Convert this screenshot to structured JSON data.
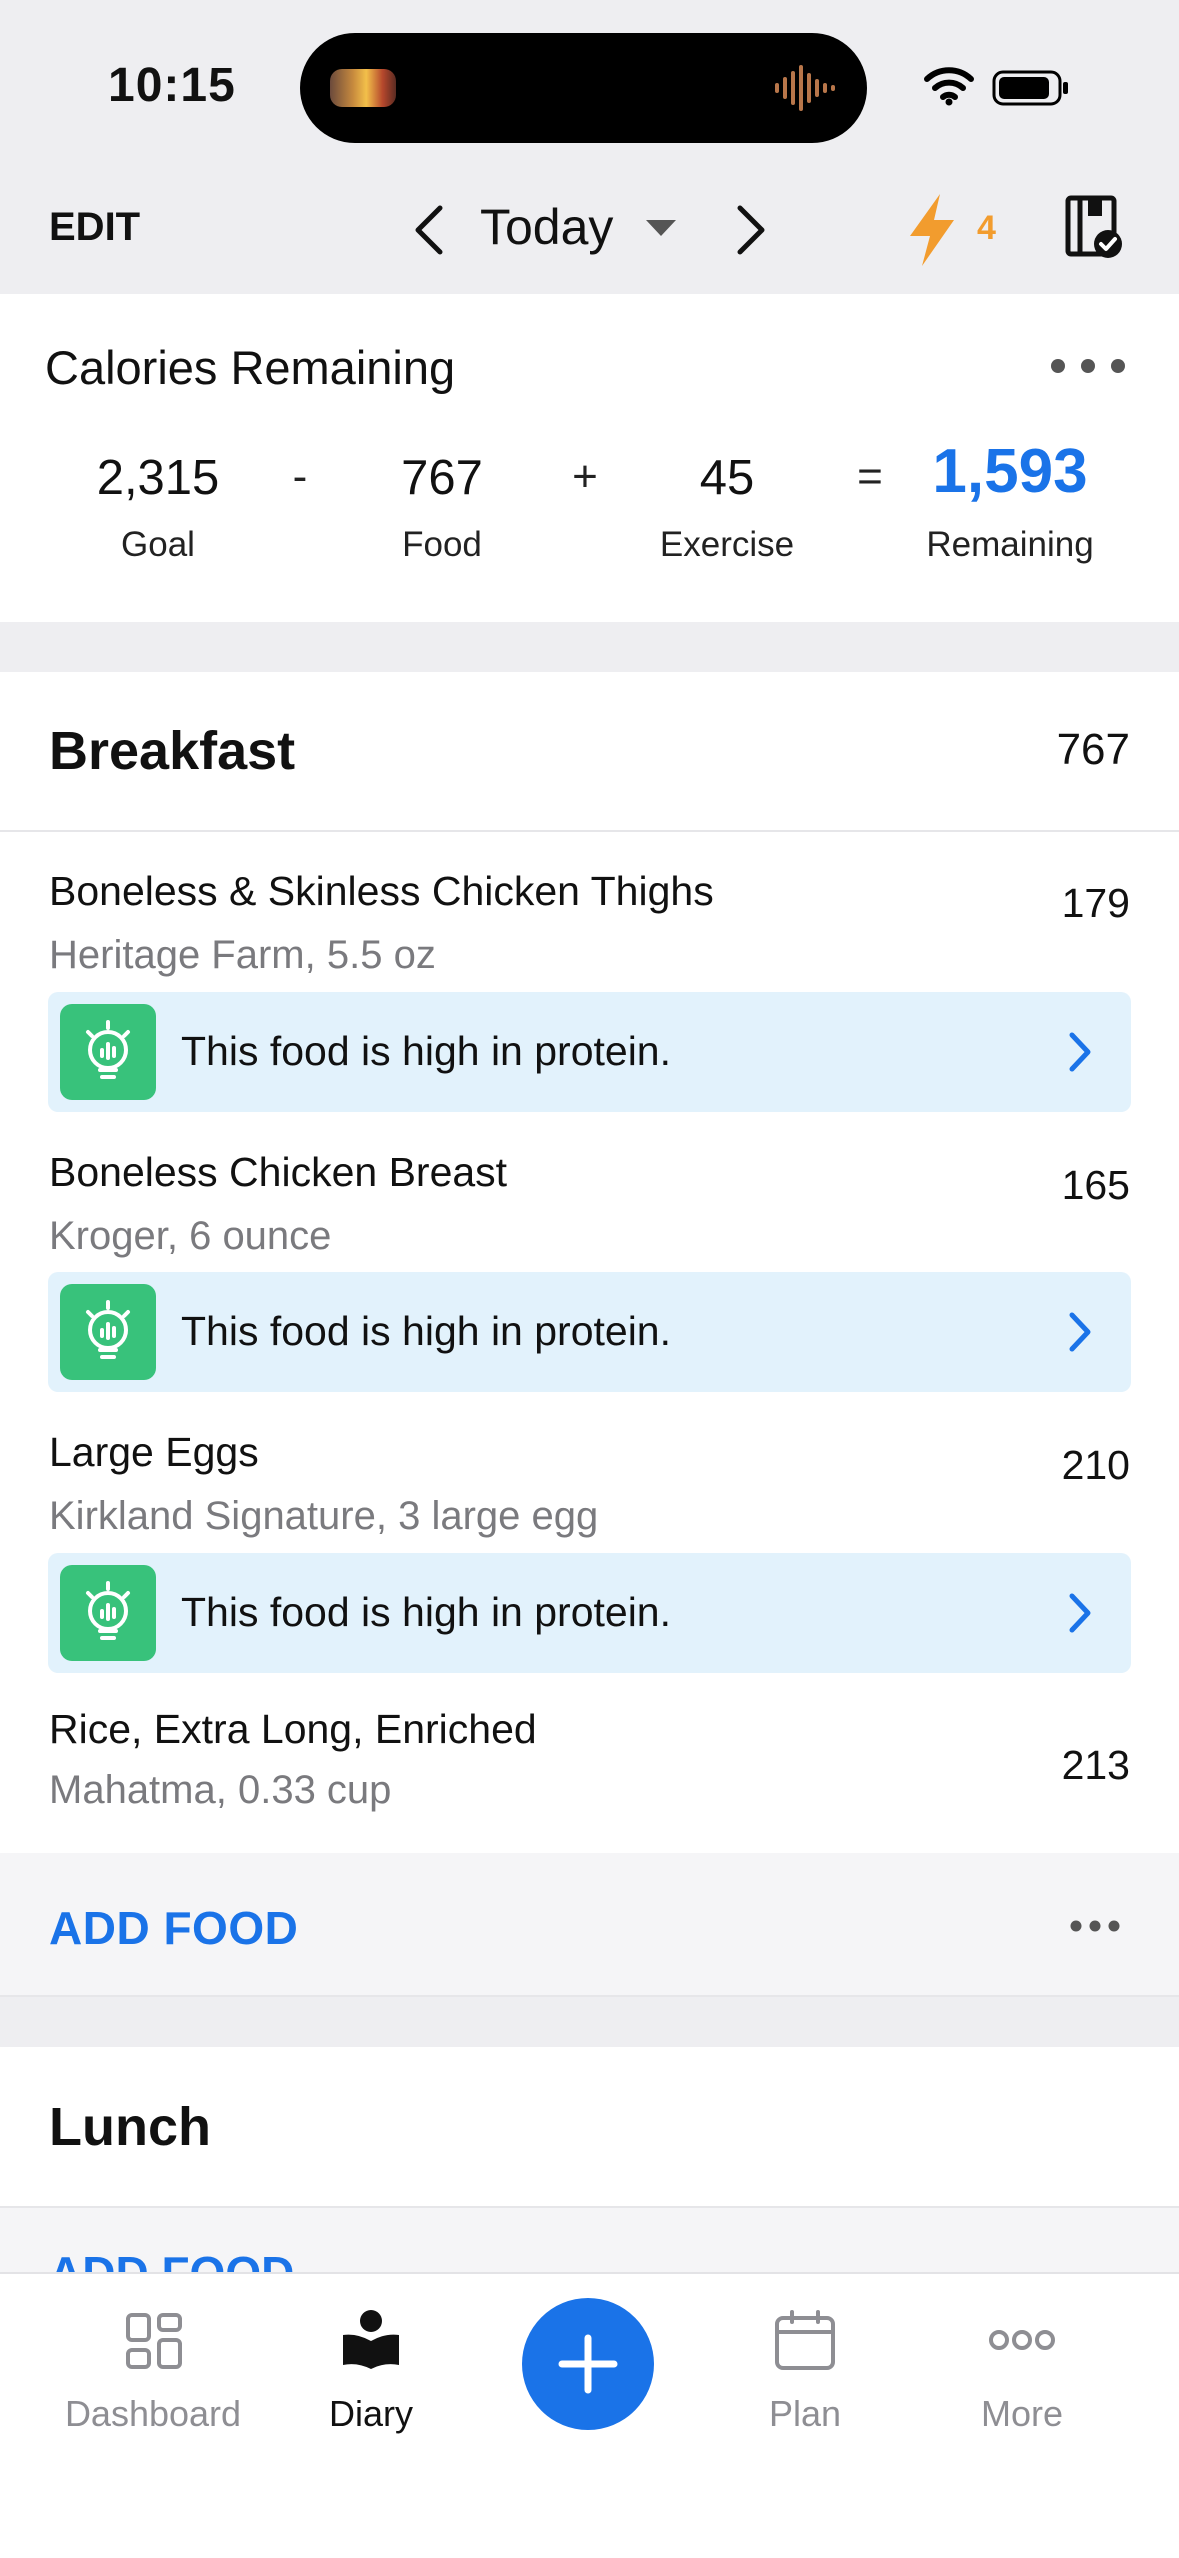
{
  "status_bar": {
    "time": "10:15"
  },
  "header": {
    "edit_label": "EDIT",
    "date_label": "Today",
    "streak_count": "4",
    "accent_color": "#f29c2e"
  },
  "calories": {
    "title": "Calories Remaining",
    "goal": {
      "value": "2,315",
      "label": "Goal"
    },
    "op_minus": "-",
    "food": {
      "value": "767",
      "label": "Food"
    },
    "op_plus": "+",
    "exercise": {
      "value": "45",
      "label": "Exercise"
    },
    "op_equals": "=",
    "remaining": {
      "value": "1,593",
      "label": "Remaining",
      "color": "#1a73e8"
    }
  },
  "breakfast": {
    "name": "Breakfast",
    "total": "767",
    "items": [
      {
        "name": "Boneless & Skinless Chicken Thighs",
        "detail": "Heritage Farm, 5.5 oz",
        "calories": "179",
        "insight": "This food is high in protein."
      },
      {
        "name": "Boneless Chicken Breast",
        "detail": "Kroger, 6 ounce",
        "calories": "165",
        "insight": "This food is high in protein."
      },
      {
        "name": "Large Eggs",
        "detail": "Kirkland Signature, 3 large egg",
        "calories": "210",
        "insight": "This food is high in protein."
      },
      {
        "name": "Rice, Extra Long, Enriched",
        "detail": "Mahatma, 0.33 cup",
        "calories": "213"
      }
    ],
    "add_food_label": "ADD FOOD"
  },
  "lunch": {
    "name": "Lunch",
    "add_food_label": "ADD FOOD"
  },
  "tabbar": {
    "tabs": [
      {
        "label": "Dashboard",
        "icon": "dashboard-icon"
      },
      {
        "label": "Diary",
        "icon": "diary-icon",
        "active": true
      },
      {
        "label": "Plan",
        "icon": "calendar-icon"
      },
      {
        "label": "More",
        "icon": "more-icon"
      }
    ],
    "add_button_icon": "plus-icon"
  }
}
